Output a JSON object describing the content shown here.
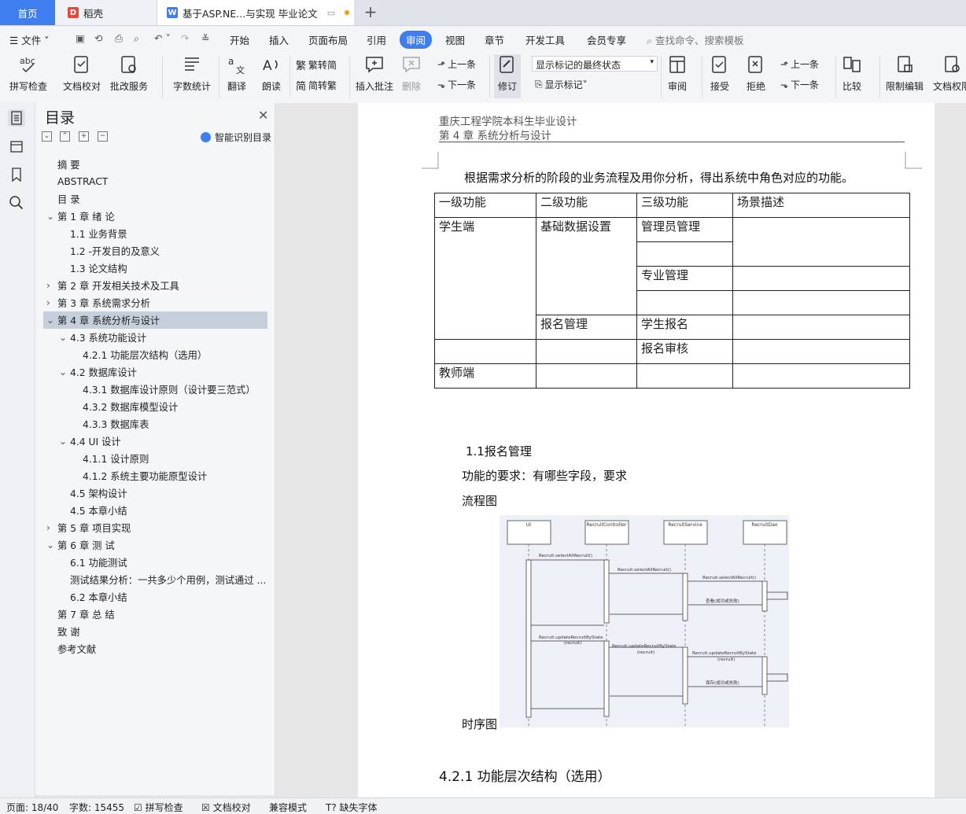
{
  "tabs": {
    "home": "首页",
    "daoke": "稻壳",
    "doc": "基于ASP.NE...与实现 毕业论文"
  },
  "menu": {
    "file": "文件",
    "items": [
      "开始",
      "插入",
      "页面布局",
      "引用",
      "审阅",
      "视图",
      "章节",
      "开发工具",
      "会员专享"
    ],
    "search": "查找命令、搜索模板"
  },
  "ribbon": {
    "spell_check": "拼写检查",
    "doc_proof": "文档校对",
    "batch_service": "批改服务",
    "word_count": "字数统计",
    "translate": "翻译",
    "read_aloud": "朗读",
    "to_traditional": "繁转简",
    "to_simplified": "简转繁",
    "insert_comment": "插入批注",
    "delete": "删除",
    "prev": "上一条",
    "next": "下一条",
    "revise": "修订",
    "markup_state": "显示标记的最终状态",
    "show_markup": "显示标记",
    "review": "审阅",
    "accept": "接受",
    "reject": "拒绝",
    "prev2": "上一条",
    "next2": "下一条",
    "compare": "比较",
    "restrict_edit": "限制编辑",
    "doc_perm": "文档权限"
  },
  "toc": {
    "title": "目录",
    "smart": "智能识别目录",
    "items": [
      "摘  要",
      "ABSTRACT",
      "目  录",
      "第 1 章  绪  论",
      "1.1  业务背景",
      "1.2 -开发目的及意义",
      "1.3  论文结构",
      "第 2 章  开发相关技术及工具",
      "第 3 章  系统需求分析",
      "第 4 章  系统分析与设计",
      "4.3  系统功能设计",
      "4.2.1  功能层次结构（选用）",
      "4.2  数据库设计",
      "4.3.1  数据库设计原则（设计要三范式）",
      "4.3.2  数据库模型设计",
      "4.3.3  数据库表",
      "4.4 UI 设计",
      "4.1.1  设计原则",
      "4.1.2  系统主要功能原型设计",
      "4.5  架构设计",
      "4.5  本章小结",
      "第 5 章  项目实现",
      "第 6 章  测  试",
      "6.1  功能测试",
      "测试结果分析：一共多少个用例，测试通过 ...",
      "6.2 本章小结",
      "第 7 章  总  结",
      "致  谢",
      "参考文献"
    ]
  },
  "doc": {
    "header1": "重庆工程学院本科生毕业设计",
    "header2": "第 4 章  系统分析与设计",
    "intro": "根据需求分析的阶段的业务流程及用你分析，得出系统中角色对应的功能。",
    "table": {
      "h1": "一级功能",
      "h2": "二级功能",
      "h3": "三级功能",
      "h4": "场景描述",
      "student": "学生端",
      "basic": "基础数据设置",
      "admin": "管理员管理",
      "major": "专业管理",
      "signup": "报名管理",
      "stu_signup": "学生报名",
      "signup_review": "报名审核",
      "teacher": "教师端"
    },
    "sec": "1.1报名管理",
    "req": "功能的要求：有哪些字段，要求",
    "flow": "流程图",
    "seq_caption": "时序图",
    "h421": "4.2.1  功能层次结构（选用）",
    "seq": {
      "ui": "UI",
      "controller": "RecruitController",
      "service": "RecruitService",
      "dao": "RecruitDao",
      "m1": "Recruit.selectAllRecruit()",
      "m2": "Recruit.selectAllRecruit()",
      "m3": "Recruit.selectAllRecruit()",
      "m4": "查看(成功或失败)",
      "m5a": "Recruit.updateRecruitByState",
      "m5b": "(recruit)",
      "m6a": "Recruit.updateRecruitByState",
      "m6b": "(recruit)",
      "m7a": "Recruit.updateRecruitByState",
      "m7b": "(recruit)",
      "m8": "保存(成功或失败)"
    }
  },
  "status": {
    "page": "页面: 18/40",
    "words": "字数: 15455",
    "spell": "拼写检查",
    "proof": "文档校对",
    "compat": "兼容模式",
    "missing_font": "缺失字体"
  },
  "colors": {
    "accent": "#3f7ef0",
    "selected_toc": "#c6d0dc"
  }
}
